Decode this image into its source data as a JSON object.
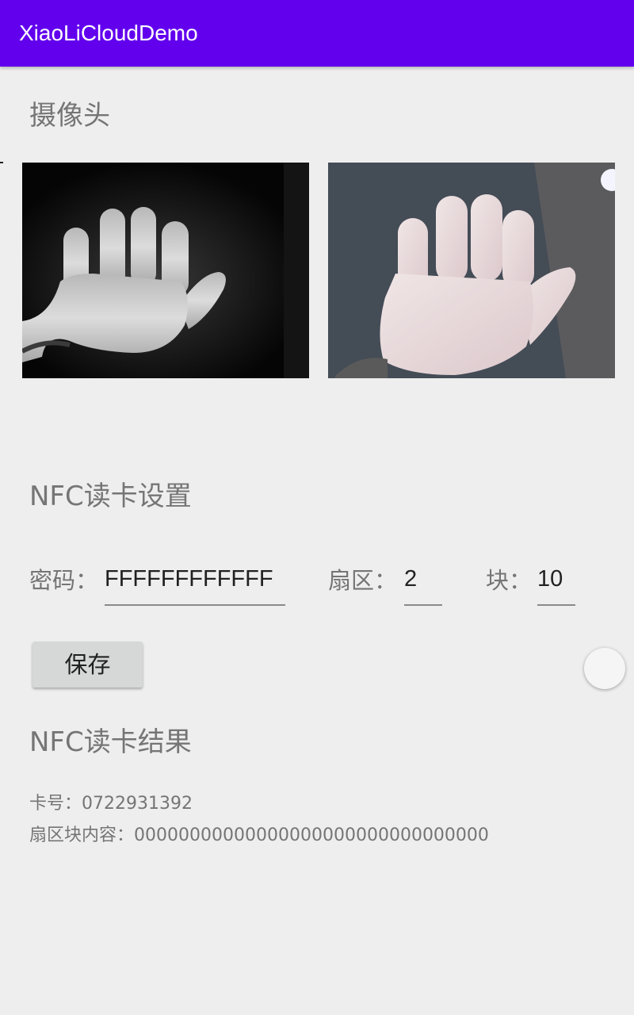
{
  "app_bar": {
    "title": "XiaoLiCloudDemo",
    "background": "#6200ee"
  },
  "camera": {
    "title": "摄像头",
    "ir_preview": {
      "icon": "ir-camera-hand-image"
    },
    "rgb_preview": {
      "icon": "rgb-camera-hand-image"
    }
  },
  "nfc_settings": {
    "title": "NFC读卡设置",
    "password_label": "密码：",
    "password_value": "FFFFFFFFFFFF",
    "sector_label": "扇区：",
    "sector_value": "2",
    "block_label": "块：",
    "block_value": "10",
    "save_label": "保存"
  },
  "nfc_result": {
    "title": "NFC读卡结果",
    "card_no_label": "卡号：",
    "card_no_value": "0722931392",
    "block_content_label": "扇区块内容：",
    "block_content_value": "00000000000000000000000000000000"
  }
}
